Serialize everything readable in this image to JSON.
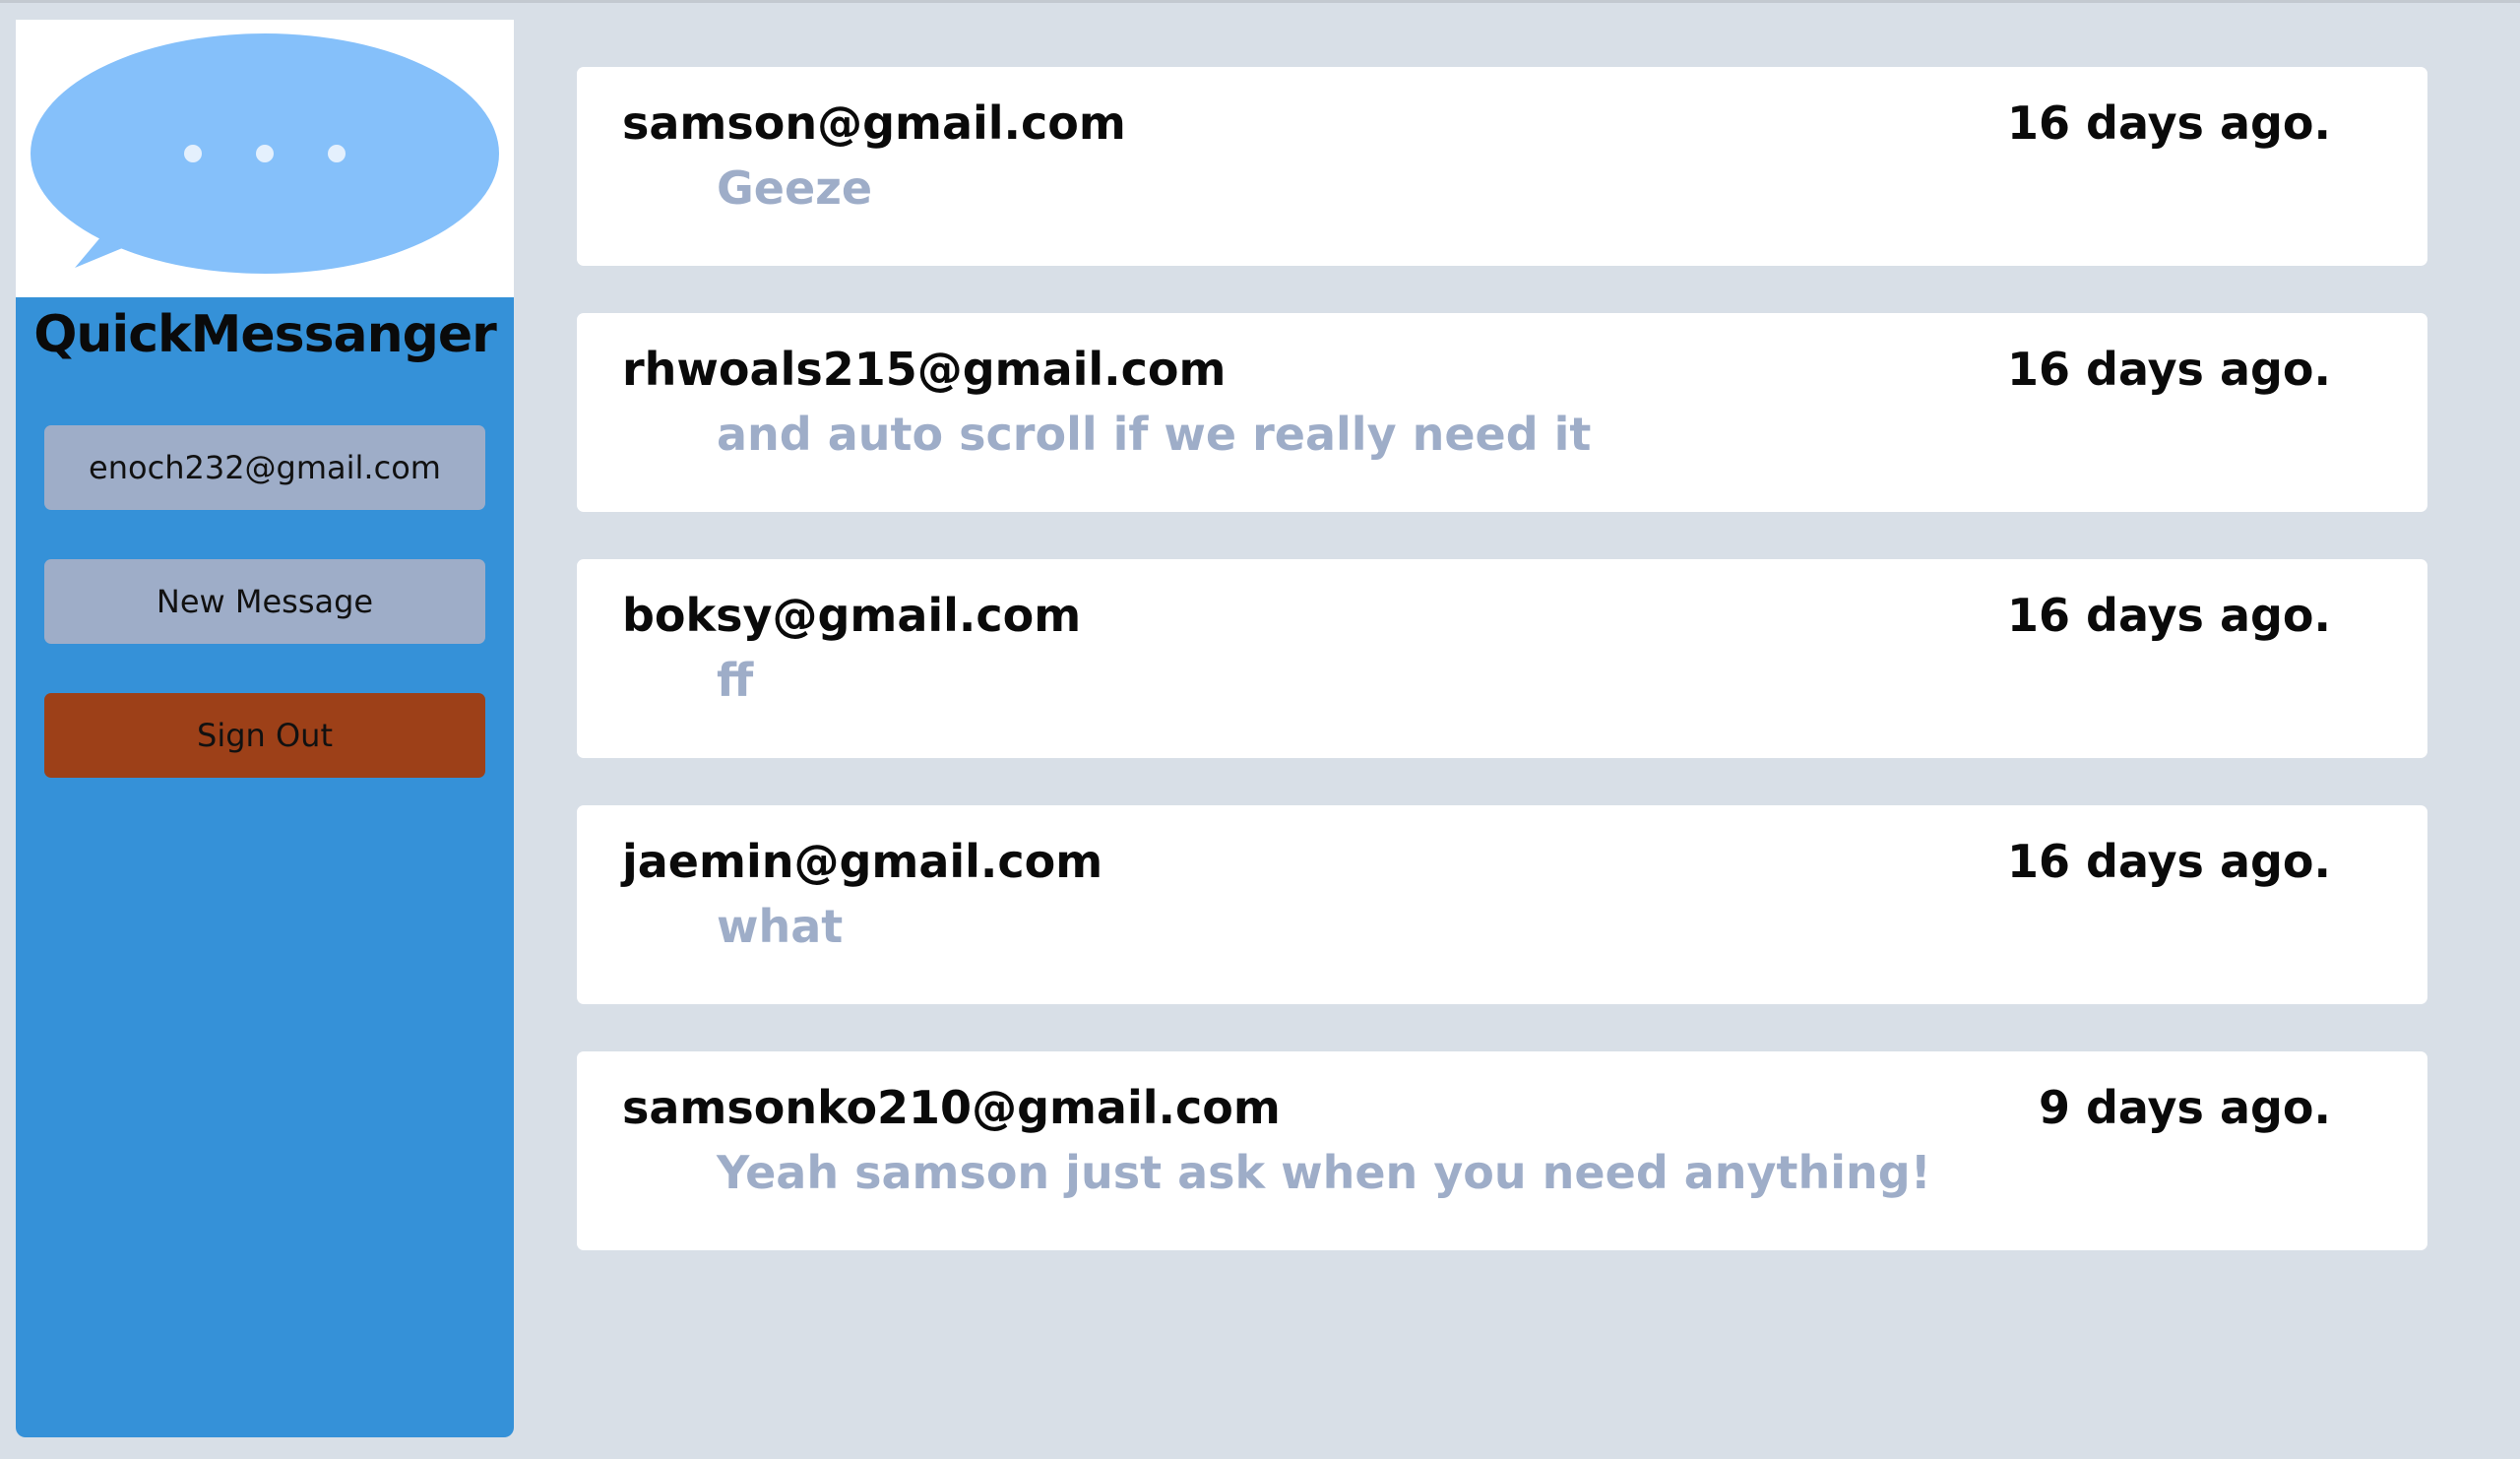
{
  "app": {
    "name": "QuickMessanger"
  },
  "sidebar": {
    "user_email": "enoch232@gmail.com",
    "new_message_label": "New Message",
    "sign_out_label": "Sign Out"
  },
  "colors": {
    "sidebar_bg": "#3591d8",
    "button_bg": "#9eadc8",
    "sign_out_bg": "#9d4018",
    "page_bg": "#d8dfe7",
    "logo_bubble": "#85c0fa",
    "preview_text": "#9eadc8"
  },
  "icons": {
    "logo": "speech-bubble-icon"
  },
  "messages": [
    {
      "sender": "samson@gmail.com",
      "time": "16 days ago.",
      "preview": "Geeze"
    },
    {
      "sender": "rhwoals215@gmail.com",
      "time": "16 days ago.",
      "preview": "and auto scroll if we really need it"
    },
    {
      "sender": "boksy@gmail.com",
      "time": "16 days ago.",
      "preview": "ff"
    },
    {
      "sender": "jaemin@gmail.com",
      "time": "16 days ago.",
      "preview": "what"
    },
    {
      "sender": "samsonko210@gmail.com",
      "time": "9 days ago.",
      "preview": "Yeah samson just ask when you need anything!"
    }
  ]
}
